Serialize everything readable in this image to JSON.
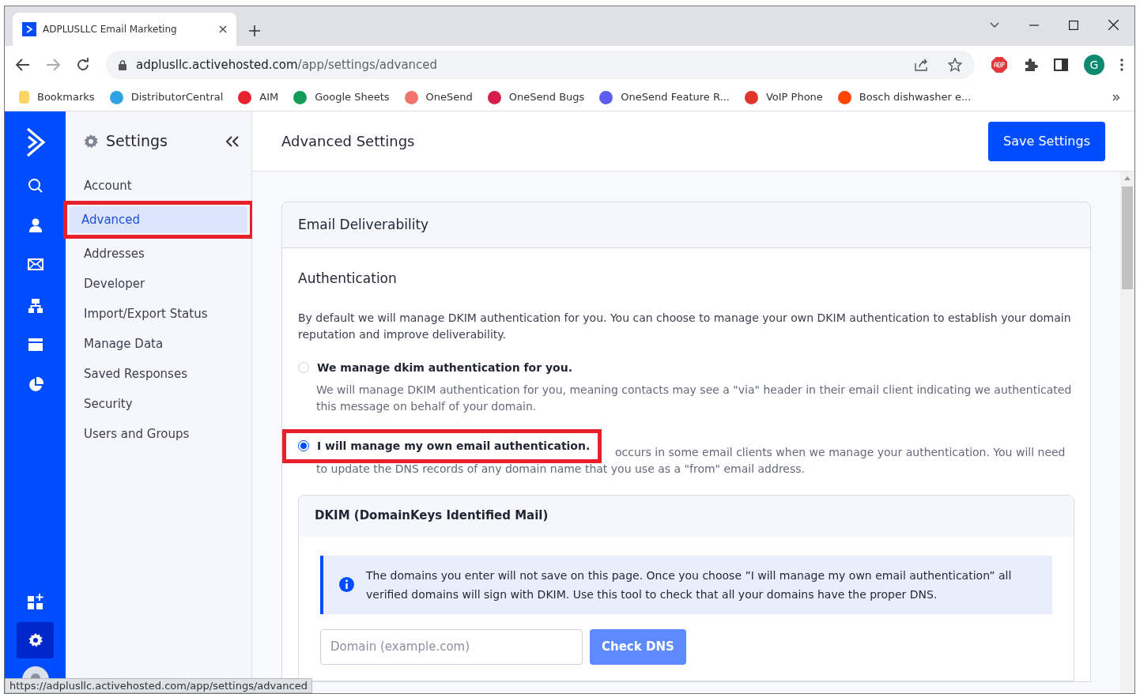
{
  "browser": {
    "tab_title": "ADPLUSLLC Email Marketing",
    "url_host": "adplusllc.activehosted.com",
    "url_path": "/app/settings/advanced",
    "profile_initial": "G",
    "bookmarks": [
      {
        "label": "Bookmarks",
        "color": "#fcd663"
      },
      {
        "label": "DistributorCentral",
        "color": "#2ea3e3"
      },
      {
        "label": "AIM",
        "color": "#e8212e"
      },
      {
        "label": "Google Sheets",
        "color": "#0f9d58"
      },
      {
        "label": "OneSend",
        "color": "#f0746c"
      },
      {
        "label": "OneSend Bugs",
        "color": "#d61e4a"
      },
      {
        "label": "OneSend Feature R...",
        "color": "#5b5ef0"
      },
      {
        "label": "VoIP Phone",
        "color": "#e0352b"
      },
      {
        "label": "Bosch dishwasher e...",
        "color": "#ff4500"
      }
    ],
    "status_url": "https://adplusllc.activehosted.com/app/settings/advanced"
  },
  "sidebar": {
    "title": "Settings",
    "items": [
      {
        "label": "Account",
        "selected": false,
        "highlighted": false
      },
      {
        "label": "Advanced",
        "selected": true,
        "highlighted": true
      },
      {
        "label": "Addresses",
        "selected": false,
        "highlighted": false
      },
      {
        "label": "Developer",
        "selected": false,
        "highlighted": false
      },
      {
        "label": "Import/Export Status",
        "selected": false,
        "highlighted": false
      },
      {
        "label": "Manage Data",
        "selected": false,
        "highlighted": false
      },
      {
        "label": "Saved Responses",
        "selected": false,
        "highlighted": false
      },
      {
        "label": "Security",
        "selected": false,
        "highlighted": false
      },
      {
        "label": "Users and Groups",
        "selected": false,
        "highlighted": false
      }
    ]
  },
  "header": {
    "title": "Advanced Settings",
    "save_button": "Save Settings"
  },
  "card": {
    "title": "Email Deliverability",
    "section_title": "Authentication",
    "intro": "By default we will manage DKIM authentication for you. You can choose to manage your own DKIM authentication to establish your domain reputation and improve deliverability.",
    "options": [
      {
        "label": "We manage dkim authentication for you.",
        "selected": false,
        "highlighted": false,
        "description": [
          "We will manage DKIM authentication for you, meaning contacts may see a \"via\" header in their email client indicating we authenticated this message on behalf of your domain."
        ]
      },
      {
        "label": "I will manage my own email authentication.",
        "selected": true,
        "highlighted": true,
        "description": [
          "occurs in some email clients when we manage your authentication. You will need",
          "to update the DNS records of any domain name that you use as a \"from\" email address."
        ]
      }
    ],
    "dkim": {
      "title": "DKIM (DomainKeys Identified Mail)",
      "info": "The domains you enter will not save on this page. Once you choose ”I will manage my own email authentication” all verified domains will sign with DKIM. Use this tool to check that all your domains have the proper DNS.",
      "placeholder": "Domain (example.com)",
      "button": "Check DNS"
    }
  }
}
